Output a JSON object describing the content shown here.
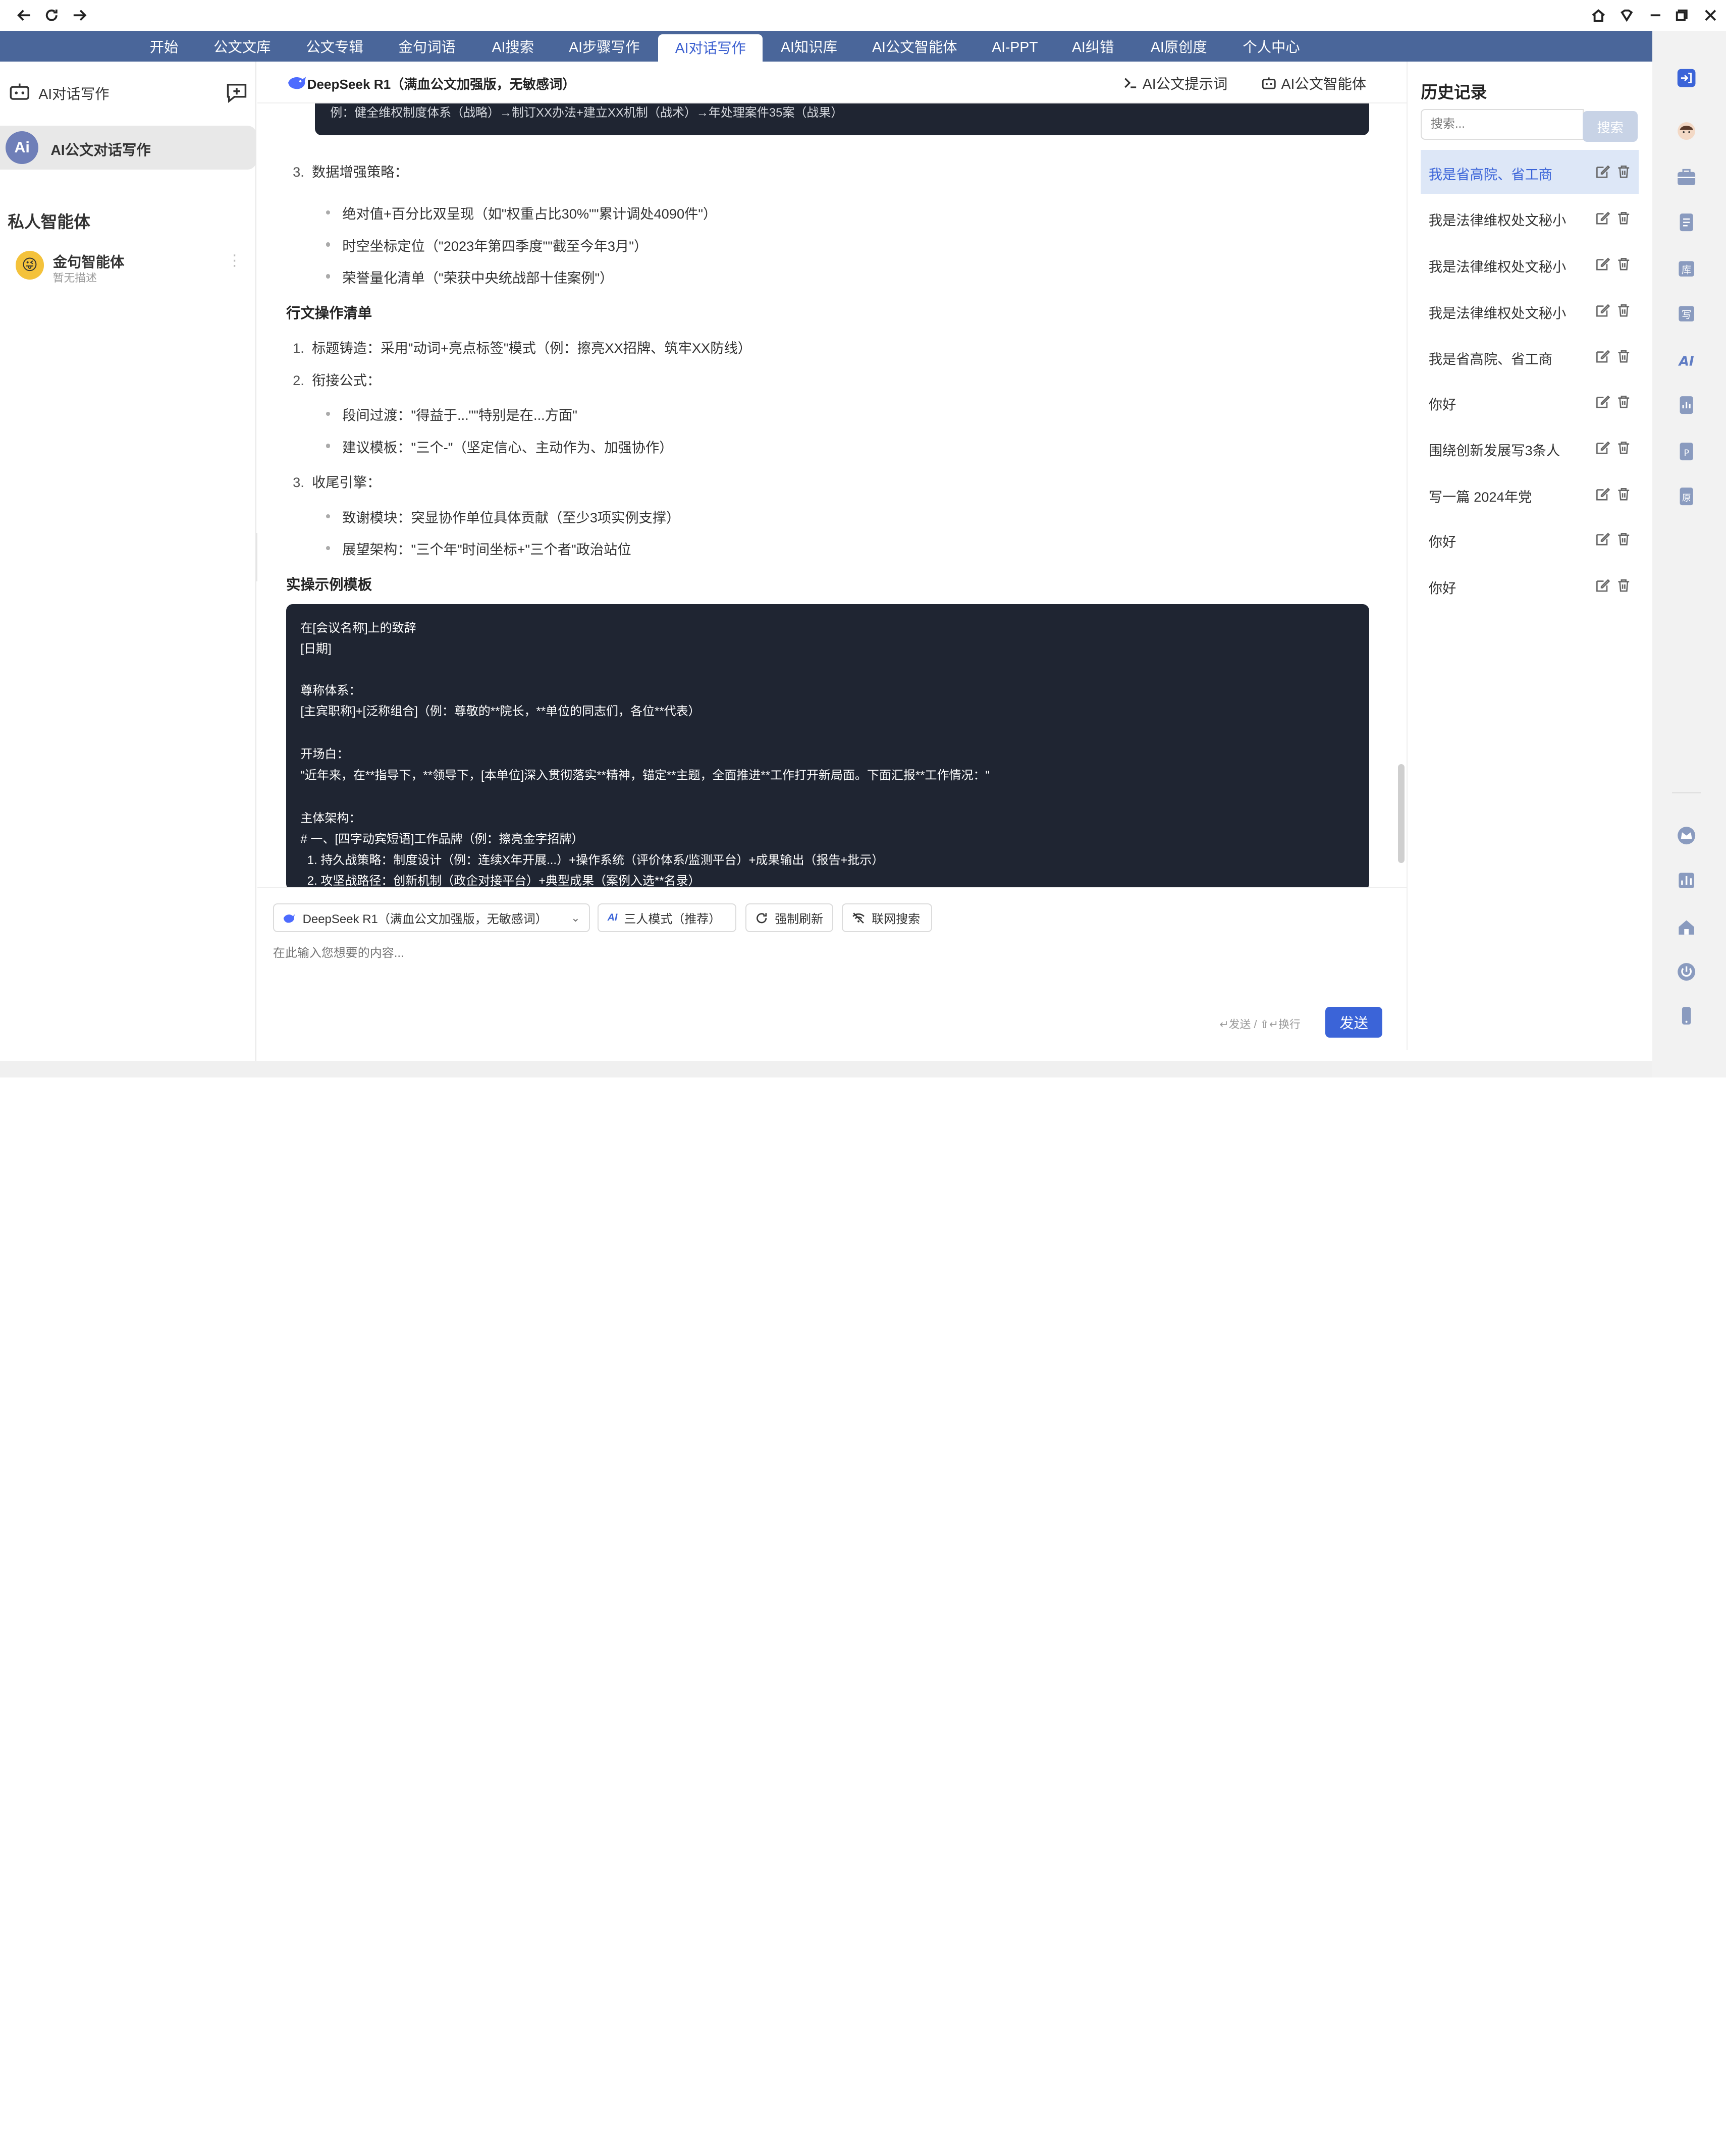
{
  "nav": {
    "items": [
      {
        "label": "开始"
      },
      {
        "label": "公文文库"
      },
      {
        "label": "公文专辑"
      },
      {
        "label": "金句词语"
      },
      {
        "label": "AI搜索"
      },
      {
        "label": "AI步骤写作"
      },
      {
        "label": "AI对话写作"
      },
      {
        "label": "AI知识库"
      },
      {
        "label": "AI公文智能体"
      },
      {
        "label": "AI-PPT"
      },
      {
        "label": "AI纠错"
      },
      {
        "label": "AI原创度"
      },
      {
        "label": "个人中心"
      }
    ],
    "active": "AI对话写作"
  },
  "sidebar": {
    "title": "AI对话写作",
    "active_item": "AI公文对话写作",
    "logo_text": "Ai",
    "section_title": "私人智能体",
    "agents": [
      {
        "name": "金句智能体",
        "desc": "暂无描述"
      }
    ]
  },
  "main": {
    "model_title": "DeepSeek R1（满血公文加强版，无敏感词）",
    "header_links": {
      "prompt": "AI公文提示词",
      "agent": "AI公文智能体"
    },
    "code_top_text": "例：健全维权制度体系（战略）→制订XX办法+建立XX机制（战术）→年处理案件35案（战果）",
    "section3": {
      "num": "3.",
      "title": "数据增强策略：",
      "bullets": [
        "绝对值+百分比双呈现（如\"权重占比30%\"\"累计调处4090件\"）",
        "时空坐标定位（\"2023年第四季度\"\"截至今年3月\"）",
        "荣誉量化清单（\"荣获中央统战部十佳案例\"）"
      ]
    },
    "ops_heading": "行文操作清单",
    "ops": [
      {
        "num": "1.",
        "title": "标题铸造：采用\"动词+亮点标签\"模式（例：擦亮XX招牌、筑牢XX防线）"
      },
      {
        "num": "2.",
        "title": "衔接公式：",
        "bullets": [
          "段间过渡：\"得益于...\"\"特别是在...方面\"",
          "建议模板：\"三个-\"（坚定信心、主动作为、加强协作）"
        ]
      },
      {
        "num": "3.",
        "title": "收尾引擎：",
        "bullets": [
          "致谢模块：突显协作单位具体贡献（至少3项实例支撑）",
          "展望架构：\"三个年\"时间坐标+\"三个者\"政治站位"
        ]
      }
    ],
    "example_heading": "实操示例模板",
    "code_lines": [
      "在[会议名称]上的致辞",
      "[日期]",
      "",
      "尊称体系：",
      "[主宾职称]+[泛称组合]（例：尊敬的**院长，**单位的同志们，各位**代表）",
      "",
      "开场白：",
      "\"近年来，在**指导下，**领导下，[本单位]深入贯彻落实**精神，锚定**主题，全面推进**工作打开新局面。下面汇报**工作情况：\"",
      "",
      "主体架构：",
      "# 一、[四字动宾短语]工作品牌（例：擦亮金字招牌）",
      "  1. 持久战策略：制度设计（例：连续X年开展...）+操作系统（评价体系/监测平台）+成果输出（报告+批示）",
      "  2. 攻坚战路径：创新机制（政企对接平台）+典型成果（案例入选**名录）"
    ]
  },
  "input": {
    "model_select": "DeepSeek R1（满血公文加强版，无敏感词）",
    "mode": "三人模式（推荐）",
    "refresh": "强制刷新",
    "web_search": "联网搜索",
    "placeholder": "在此输入您想要的内容...",
    "hint": "↵发送 / ⇧↵换行",
    "send": "发送"
  },
  "history": {
    "title": "历史记录",
    "search_placeholder": "搜索...",
    "search_button": "搜索",
    "items": [
      {
        "label": "我是省高院、省工商"
      },
      {
        "label": "我是法律维权处文秘小"
      },
      {
        "label": "我是法律维权处文秘小"
      },
      {
        "label": "我是法律维权处文秘小"
      },
      {
        "label": "我是省高院、省工商"
      },
      {
        "label": "你好"
      },
      {
        "label": "围绕创新发展写3条人"
      },
      {
        "label": "写一篇 2024年党"
      },
      {
        "label": "你好"
      },
      {
        "label": "你好"
      }
    ]
  },
  "rail": {
    "labels": [
      "库",
      "写",
      "AI",
      "P",
      "原"
    ]
  },
  "colors": {
    "nav_bg": "#4a669a",
    "accent": "#3b64d8",
    "code_bg": "#1f2532"
  }
}
